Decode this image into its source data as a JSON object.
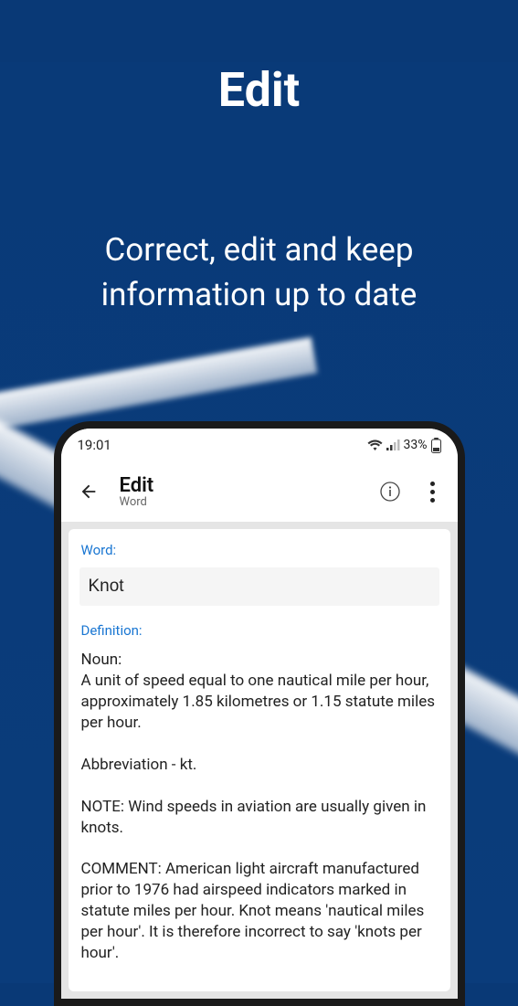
{
  "promo": {
    "title": "Edit",
    "subtitle_line1": "Correct, edit and keep",
    "subtitle_line2": "information up to date"
  },
  "status_bar": {
    "time": "19:01",
    "battery_text": "33%"
  },
  "app_bar": {
    "title": "Edit",
    "subtitle": "Word"
  },
  "form": {
    "word_label": "Word:",
    "word_value": "Knot",
    "definition_label": "Definition:",
    "definition_value": "Noun:\nA unit of speed equal to one nautical mile per hour, approximately 1.85 kilometres or 1.15 statute miles per hour.\n\nAbbreviation - kt.\n\nNOTE: Wind speeds in aviation are usually given in knots.\n\nCOMMENT: American light aircraft manufactured prior to 1976 had airspeed indicators marked in statute miles per hour. Knot means 'nautical miles per hour'. It is therefore incorrect to say 'knots per hour'."
  }
}
